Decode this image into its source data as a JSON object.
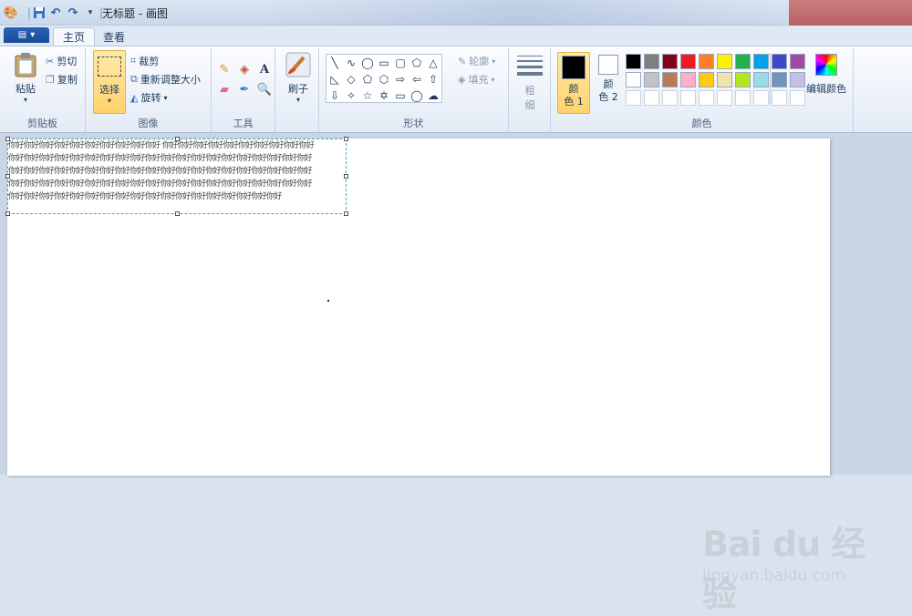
{
  "window": {
    "title": "无标题 - 画图"
  },
  "tabs": {
    "home": "主页",
    "view": "查看"
  },
  "clipboard": {
    "paste": "粘贴",
    "cut": "剪切",
    "copy": "复制",
    "group_label": "剪贴板"
  },
  "image": {
    "select": "选择",
    "crop": "裁剪",
    "resize": "重新调整大小",
    "rotate": "旋转",
    "group_label": "图像"
  },
  "tools": {
    "group_label": "工具"
  },
  "brush": {
    "label": "刷子"
  },
  "shapes": {
    "outline": "轮廓",
    "fill": "填充",
    "group_label": "形状"
  },
  "size": {
    "line1": "粗",
    "line2": "细"
  },
  "colors": {
    "color1_line1": "颜",
    "color1_line2": "色 1",
    "color2_line1": "颜",
    "color2_line2": "色 2",
    "edit": "编辑颜色",
    "group_label": "颜色",
    "color1_value": "#000000",
    "color2_value": "#ffffff",
    "palette_row1": [
      "#000000",
      "#7f7f7f",
      "#880015",
      "#ed1c24",
      "#ff7f27",
      "#fff200",
      "#22b14c",
      "#00a2e8",
      "#3f48cc",
      "#a349a4"
    ],
    "palette_row2": [
      "#ffffff",
      "#c3c3c3",
      "#b97a57",
      "#ffaec9",
      "#ffc90e",
      "#efe4b0",
      "#b5e61d",
      "#99d9ea",
      "#7092be",
      "#c8bfe7"
    ],
    "palette_row3": [
      "#ffffff",
      "#ffffff",
      "#ffffff",
      "#ffffff",
      "#ffffff",
      "#ffffff",
      "#ffffff",
      "#ffffff",
      "#ffffff",
      "#ffffff"
    ]
  },
  "canvas": {
    "text_lines": [
      "你好你好你好你好你好你好你好你好你好你好 你好你好你好你好你好你好你好你好你好你好",
      "你好你好你好你好你好你好你好你好你好你好你好你好你好你好你好你好你好你好你好你好",
      "你好你好你好你好你好你好你好你好你好你好你好你好你好你好你好你好你好你好你好你好",
      "你好你好你好你好你好你好你好你好你好你好你好你好你好你好你好你好你好你好你好你好",
      "你好你好你好你好你好你好你好你好你好你好你好你好你好你好你好你好你好你好"
    ]
  },
  "watermark": {
    "brand": "Bai du 经验",
    "url": "jingyan.baidu.com"
  }
}
